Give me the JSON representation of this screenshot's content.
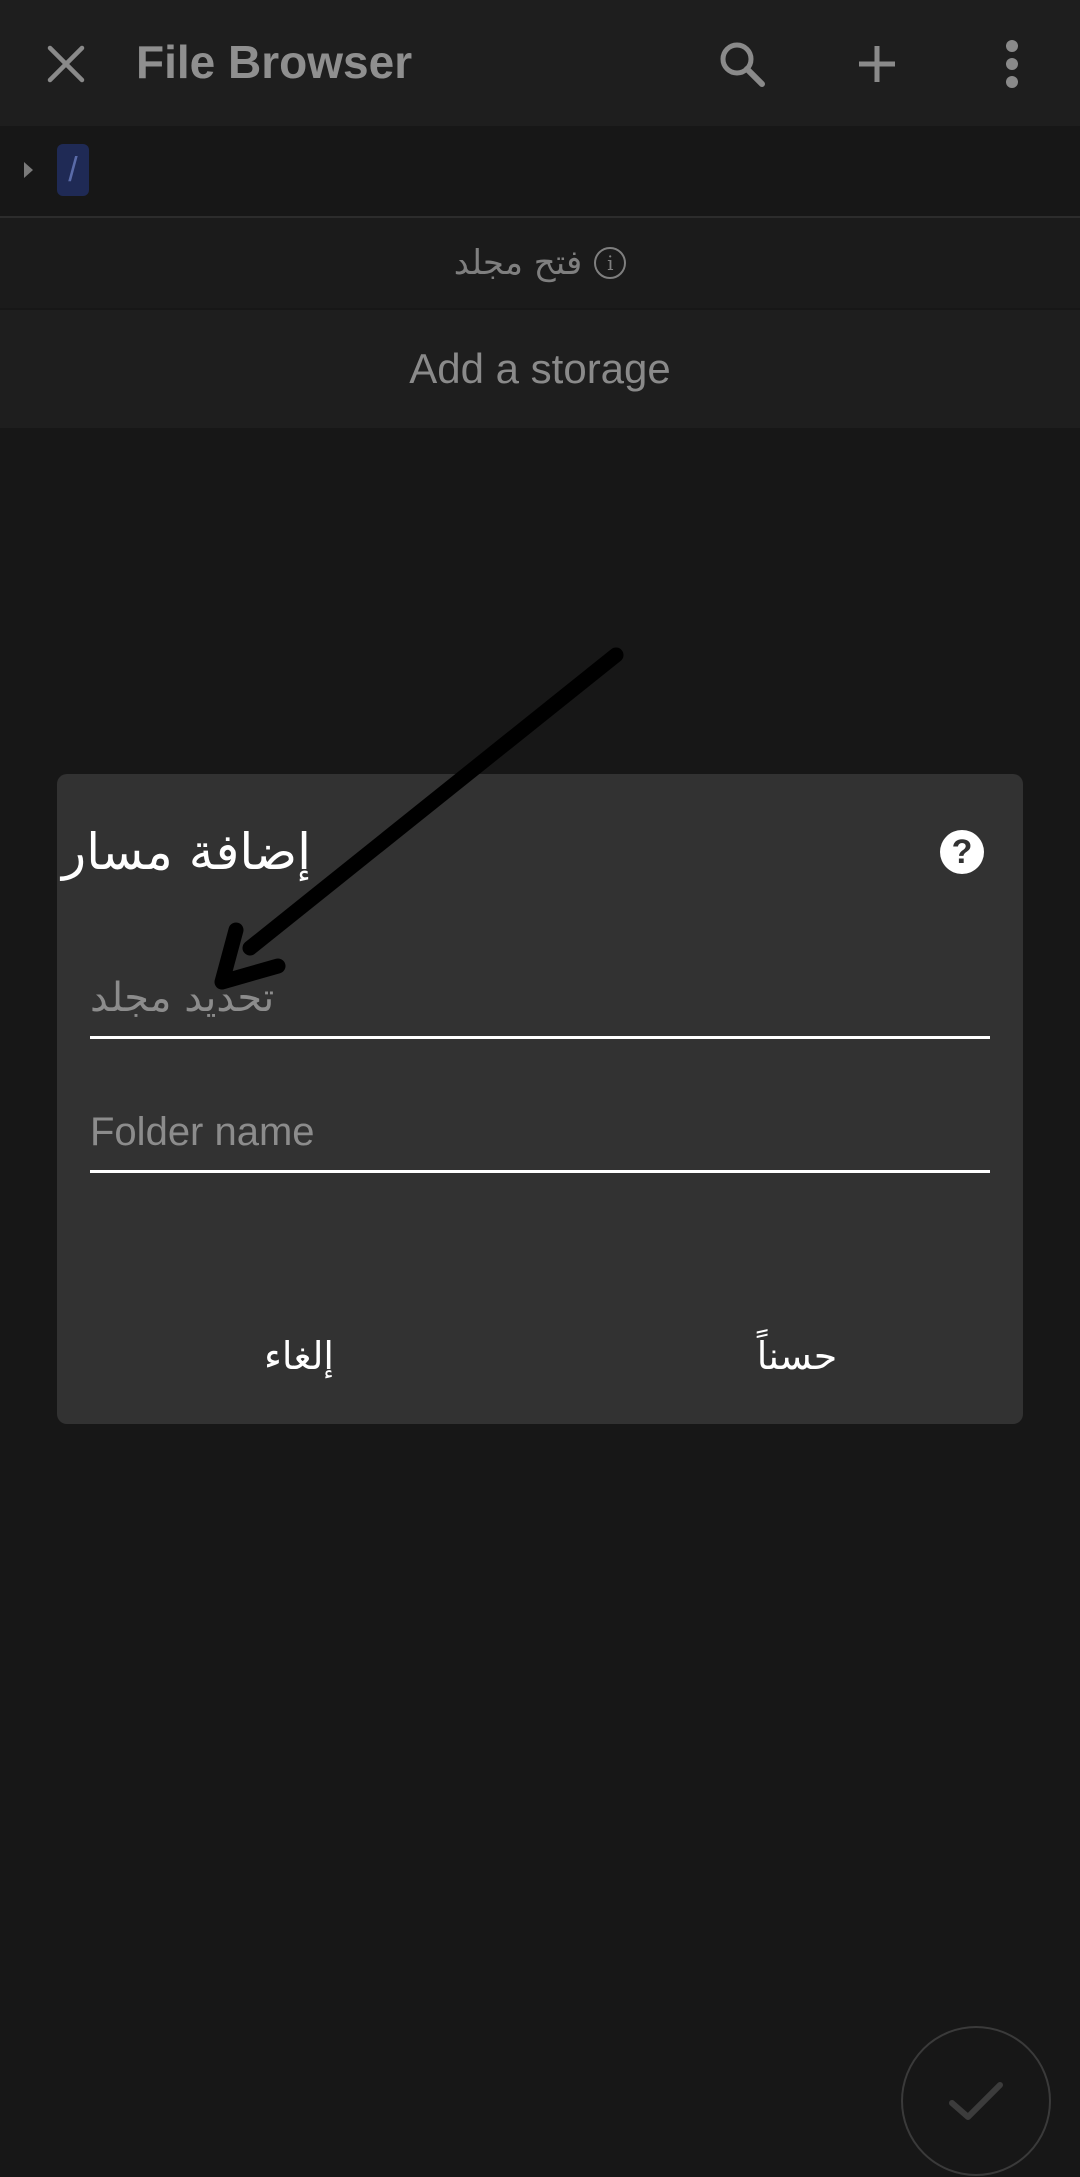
{
  "appbar": {
    "title": "File Browser",
    "icons": [
      "close-icon",
      "search-icon",
      "plus-icon",
      "more-vert-icon"
    ]
  },
  "breadcrumb": {
    "root": "/"
  },
  "open_folder": {
    "label": "فتح مجلد"
  },
  "add_storage": {
    "label": "Add a storage"
  },
  "dialog": {
    "title": "إضافة مسار",
    "help_icon": "?",
    "folder_select_placeholder": "تحديد مجلد",
    "folder_name_placeholder": "Folder name",
    "cancel_label": "إلغاء",
    "ok_label": "حسناً"
  },
  "colors": {
    "background": "#171717",
    "appbar": "#1e1e1e",
    "dialog": "#323232",
    "accent_crumb": "#1f2a55"
  }
}
